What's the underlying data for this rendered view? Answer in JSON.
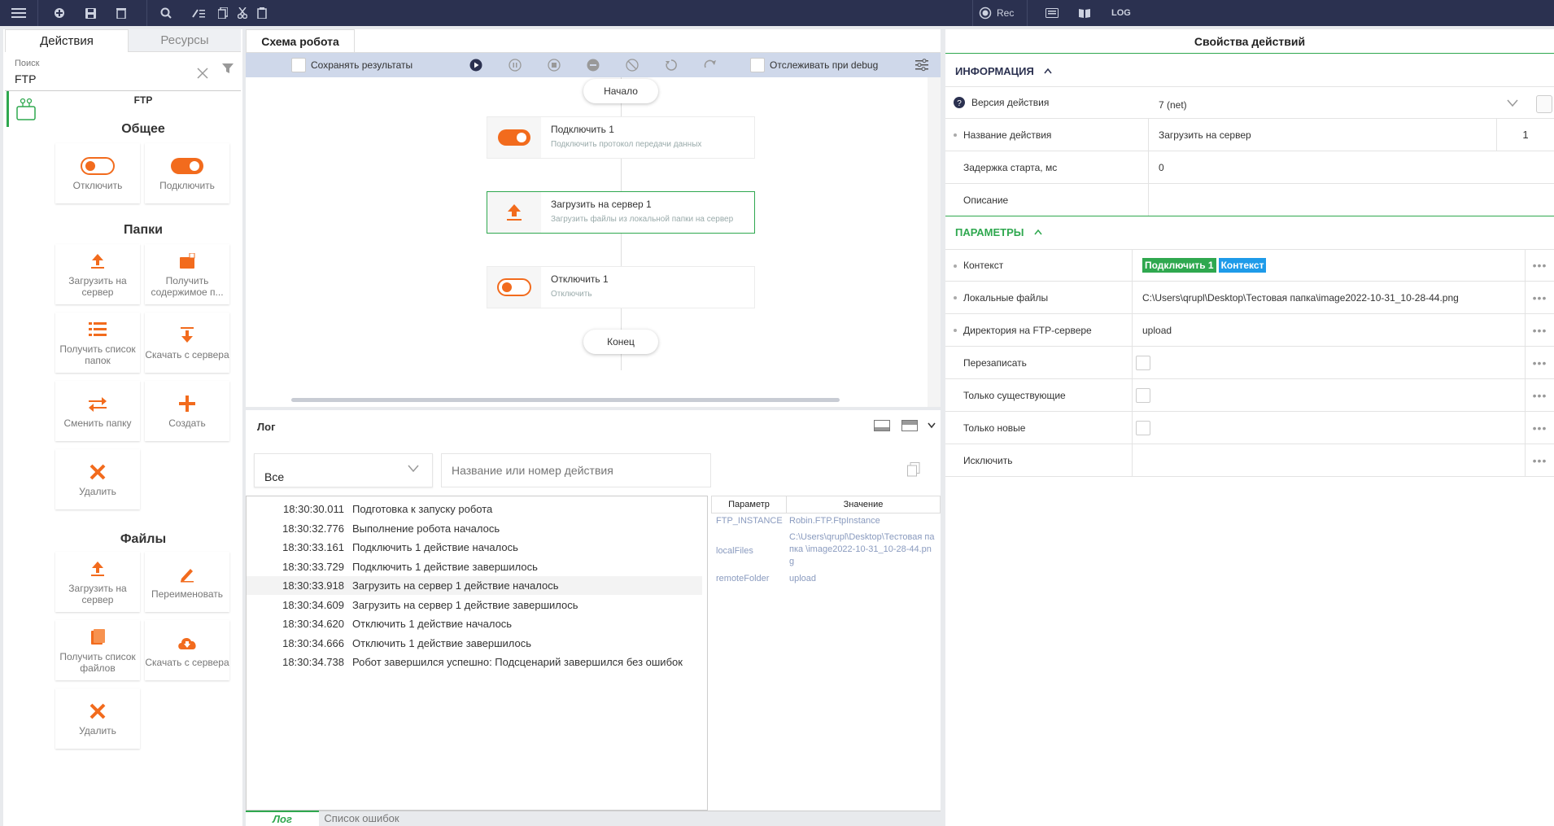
{
  "toolbar": {
    "rec_label": "Rec",
    "log_label": "LOG"
  },
  "left": {
    "tab_actions": "Действия",
    "tab_resources": "Ресурсы",
    "search_label": "Поиск",
    "search_value": "FTP",
    "group_title": "FTP",
    "sections": {
      "general": "Общее",
      "folders": "Папки",
      "files": "Файлы"
    },
    "tiles": {
      "disconnect": "Отключить",
      "connect": "Подключить",
      "upload": "Загрузить на сервер",
      "get_contents": "Получить содержимое п...",
      "get_folders": "Получить список папок",
      "download": "Скачать с сервера",
      "change_folder": "Сменить папку",
      "create": "Создать",
      "delete": "Удалить",
      "upload_file": "Загрузить на сервер",
      "rename": "Переименовать",
      "get_files": "Получить список файлов",
      "download_file": "Скачать с сервера",
      "delete_file": "Удалить"
    }
  },
  "schema": {
    "tab": "Схема робота",
    "save_results": "Сохранять результаты",
    "track_debug": "Отслеживать при debug",
    "start": "Начало",
    "end": "Конец",
    "nodes": [
      {
        "title": "Подключить  1",
        "desc": "Подключить протокол передачи данных"
      },
      {
        "title": "Загрузить на сервер  1",
        "desc": "Загрузить файлы из локальной папки на сервер"
      },
      {
        "title": "Отключить  1",
        "desc": "Отключить"
      }
    ]
  },
  "log": {
    "title": "Лог",
    "filter_value": "Все",
    "search_placeholder": "Название или номер действия",
    "rows": [
      {
        "time": "18:30:30.011",
        "msg": "Подготовка к запуску робота"
      },
      {
        "time": "18:30:32.776",
        "msg": "Выполнение робота началось"
      },
      {
        "time": "18:30:33.161",
        "msg": "Подключить 1 действие началось"
      },
      {
        "time": "18:30:33.729",
        "msg": "Подключить 1 действие завершилось"
      },
      {
        "time": "18:30:33.918",
        "msg": "Загрузить на сервер 1 действие началось"
      },
      {
        "time": "18:30:34.609",
        "msg": "Загрузить на сервер 1 действие завершилось"
      },
      {
        "time": "18:30:34.620",
        "msg": "Отключить 1 действие началось"
      },
      {
        "time": "18:30:34.666",
        "msg": "Отключить 1 действие завершилось"
      },
      {
        "time": "18:30:34.738",
        "msg": "Робот завершился успешно: Подсценарий завершился без ошибок"
      }
    ],
    "param_header": "Параметр",
    "value_header": "Значение",
    "params": [
      {
        "name": "FTP_INSTANCE",
        "value": "Robin.FTP.FtpInstance"
      },
      {
        "name": "localFiles",
        "value": "C:\\Users\\qrupl\\Desktop\\Тестовая папка \\image2022-10-31_10-28-44.png"
      },
      {
        "name": "remoteFolder",
        "value": "upload"
      }
    ],
    "bottom_tab_log": "Лог",
    "bottom_tab_errors": "Список ошибок"
  },
  "props": {
    "title": "Свойства действий",
    "info_section": "ИНФОРМАЦИЯ",
    "params_section": "ПАРАМЕТРЫ",
    "version_label": "Версия действия",
    "version_value": "7 (net)",
    "name_label": "Название действия",
    "name_value": "Загрузить на сервер",
    "name_num": "1",
    "delay_label": "Задержка старта, мс",
    "delay_value": "0",
    "desc_label": "Описание",
    "context_label": "Контекст",
    "context_tag1": "Подключить 1",
    "context_tag2": "Контекст",
    "local_label": "Локальные файлы",
    "local_value": "C:\\Users\\qrupl\\Desktop\\Тестовая папка\\image2022-10-31_10-28-44.png",
    "dir_label": "Директория на FTP-сервере",
    "dir_value": "upload",
    "overwrite_label": "Перезаписать",
    "only_existing_label": "Только существующие",
    "only_new_label": "Только новые",
    "exclude_label": "Исключить"
  },
  "colors": {
    "accent_orange": "#f26b1d",
    "accent_green": "#2fa84f",
    "topbar": "#2b3150",
    "tag_blue": "#1e9be9"
  }
}
